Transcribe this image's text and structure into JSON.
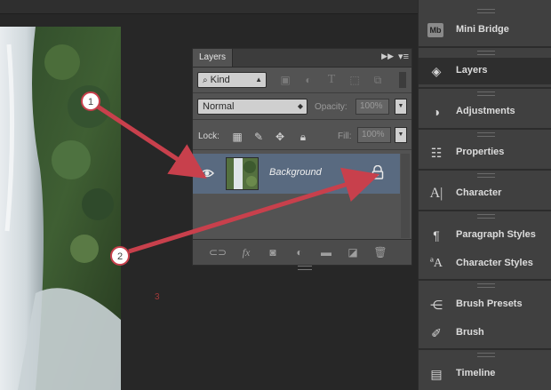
{
  "canvas": {
    "marker_text": "3"
  },
  "layers_panel": {
    "tab_label": "Layers",
    "filter_kind": "Kind",
    "blend_mode": "Normal",
    "opacity_label": "Opacity:",
    "opacity_value": "100%",
    "lock_label": "Lock:",
    "fill_label": "Fill:",
    "fill_value": "100%",
    "layers": [
      {
        "name": "Background",
        "visible": true,
        "locked": true
      }
    ]
  },
  "callouts": [
    {
      "number": "1"
    },
    {
      "number": "2"
    }
  ],
  "dock": {
    "items": [
      {
        "label": "Mini Bridge",
        "icon": "mini-bridge-icon",
        "badge": "Mb"
      },
      {
        "label": "Layers",
        "icon": "layers-icon",
        "active": true
      },
      {
        "label": "Adjustments",
        "icon": "adjustments-icon"
      },
      {
        "label": "Properties",
        "icon": "properties-icon"
      },
      {
        "label": "Character",
        "icon": "character-icon"
      },
      {
        "label": "Paragraph Styles",
        "icon": "paragraph-styles-icon"
      },
      {
        "label": "Character Styles",
        "icon": "character-styles-icon"
      },
      {
        "label": "Brush Presets",
        "icon": "brush-presets-icon"
      },
      {
        "label": "Brush",
        "icon": "brush-icon"
      },
      {
        "label": "Timeline",
        "icon": "timeline-icon"
      }
    ]
  },
  "colors": {
    "arrow": "#c8404c",
    "selected_layer": "#596a80",
    "panel": "#535353",
    "dock": "#404040"
  }
}
